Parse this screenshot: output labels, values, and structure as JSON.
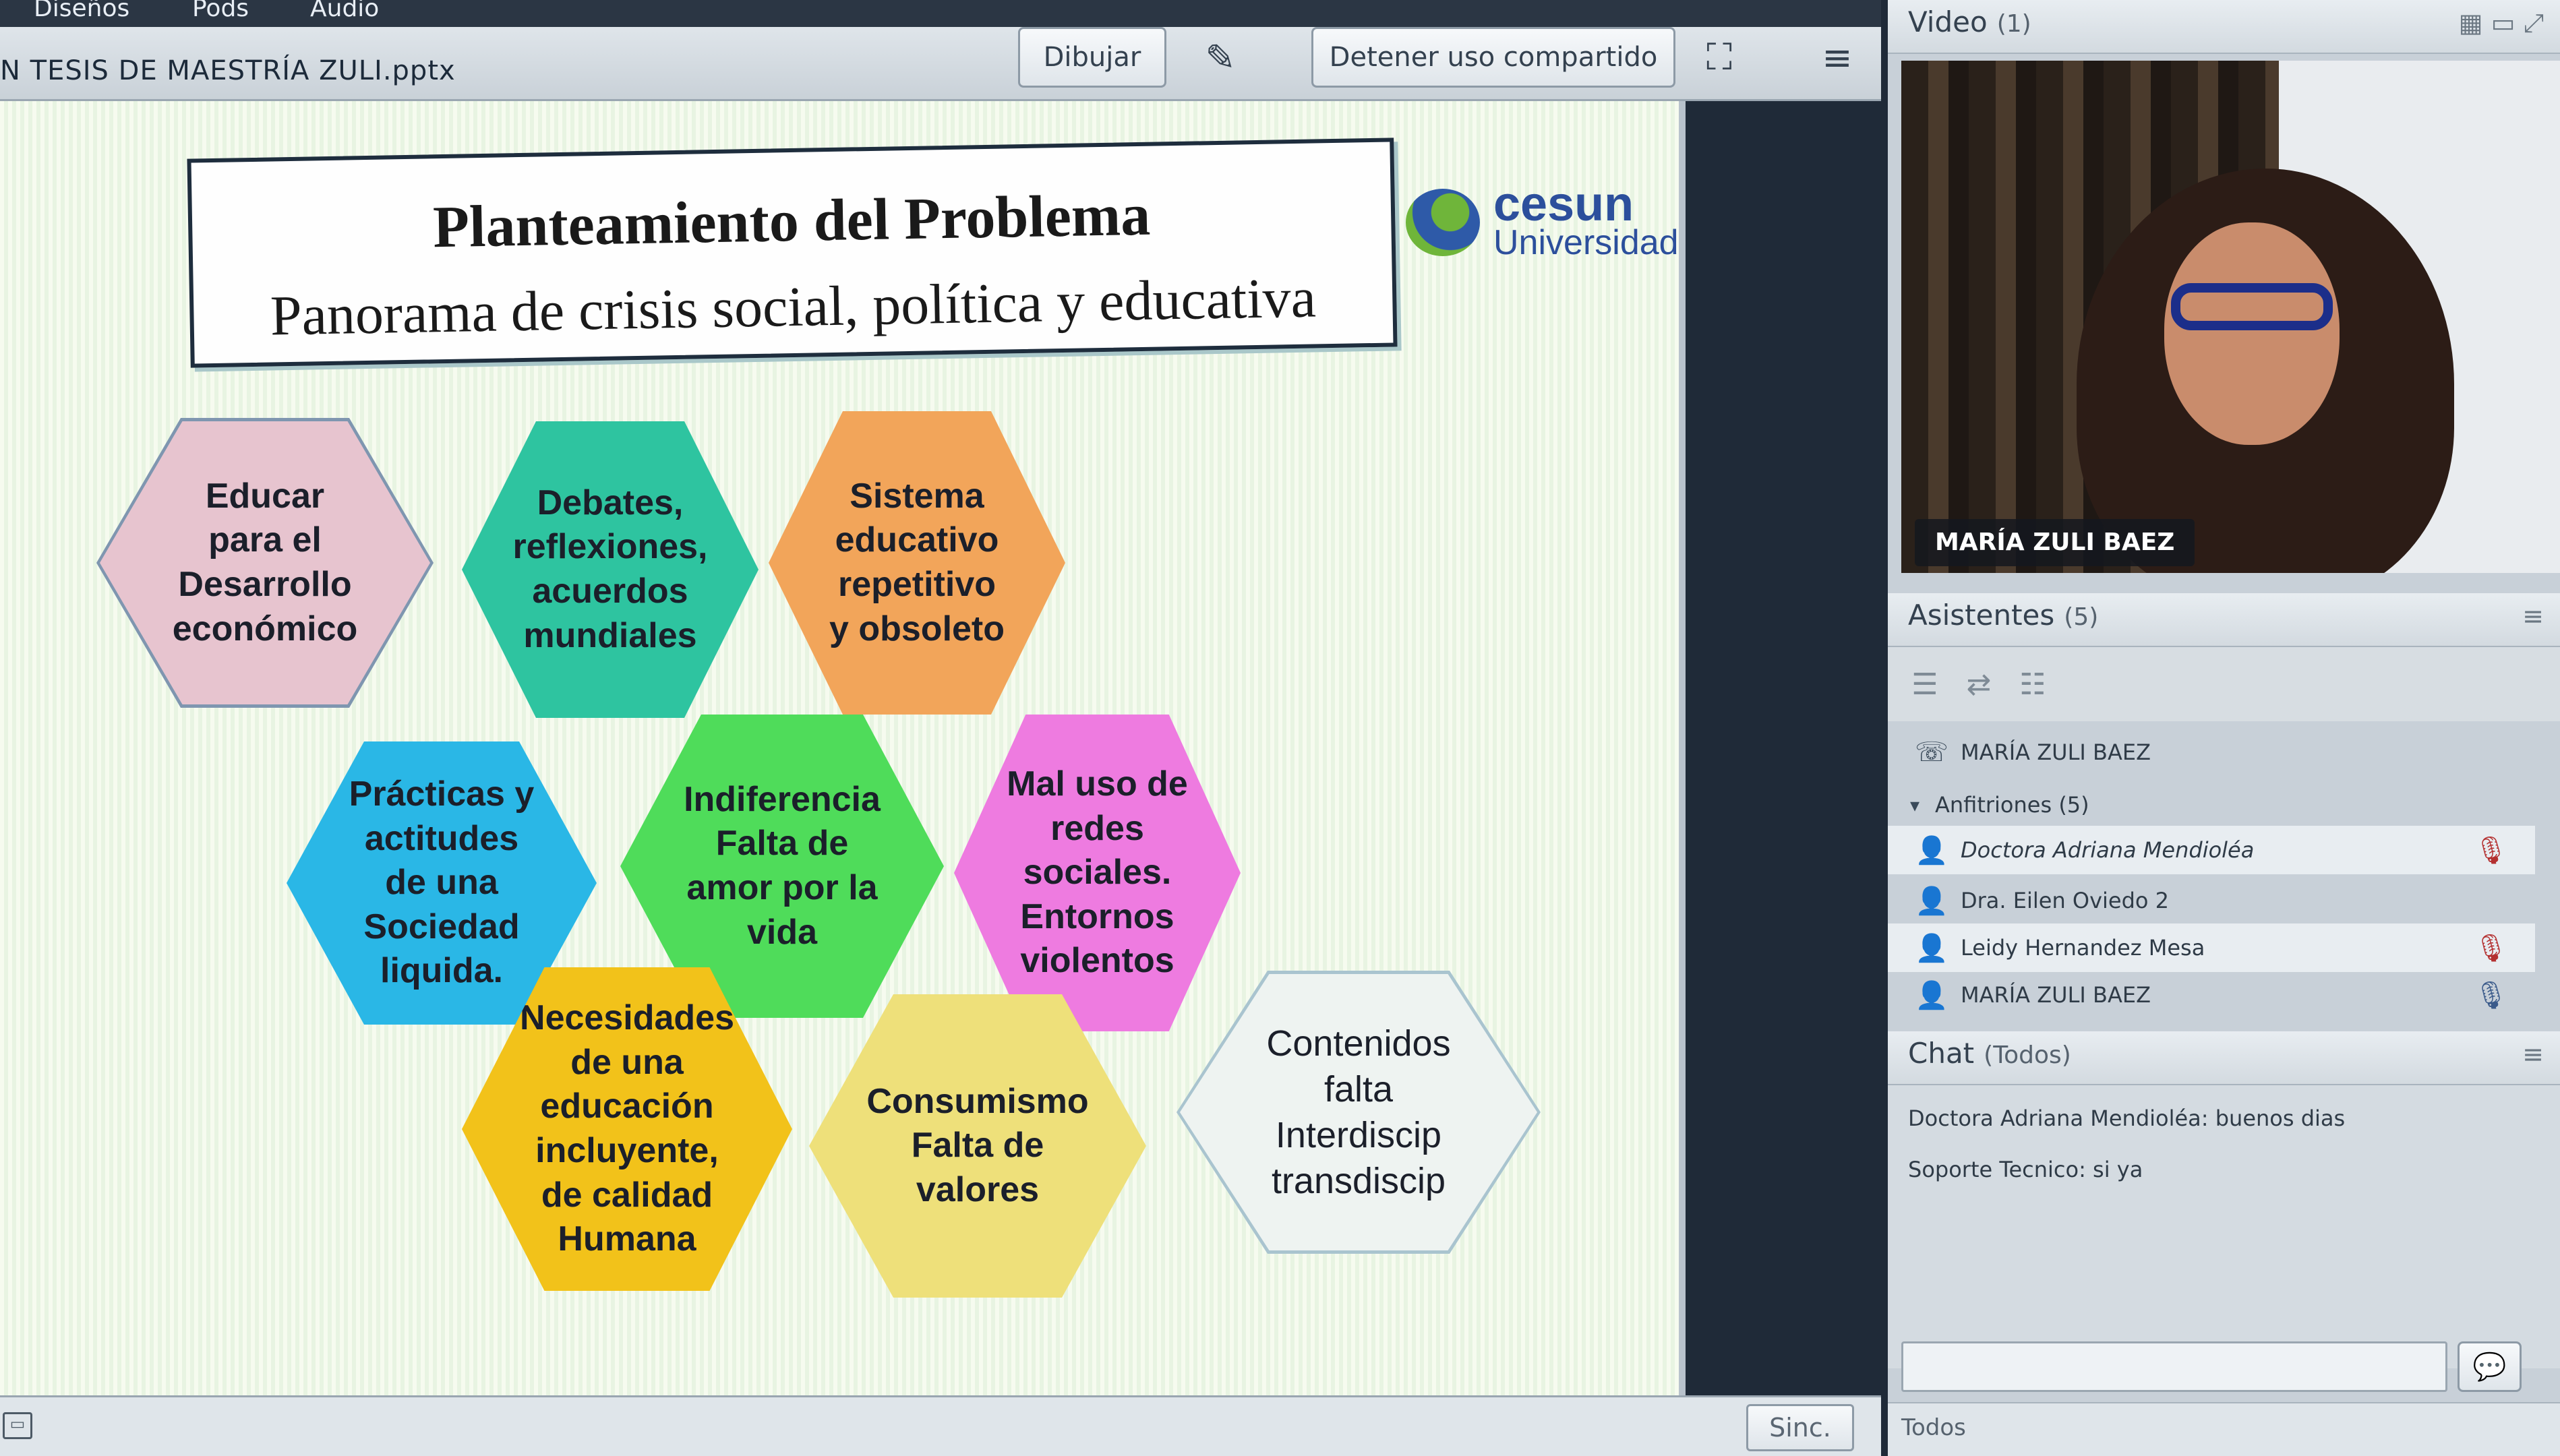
{
  "menubar": {
    "items": [
      "Diseños",
      "Pods",
      "Audio"
    ]
  },
  "toolbar": {
    "file_name": "N TESIS DE MAESTRÍA ZULI.pptx",
    "draw_label": "Dibujar",
    "pointer_icon": "pointer-icon",
    "stop_share_label": "Detener uso compartido",
    "fullscreen_icon": "fullscreen-icon",
    "menu_icon": "menu-icon"
  },
  "slide": {
    "logo": {
      "brand": "cesun",
      "sub": "Universidad"
    },
    "title": "Planteamiento del Problema",
    "subtitle": "Panorama de crisis social, política y educativa",
    "hexagons": [
      {
        "text": "Educar\npara el\nDesarrollo\neconómico",
        "color": "#e7c4cf"
      },
      {
        "text": "Debates,\nreflexiones,\nacuerdos\nmundiales",
        "color": "#2ec4a0"
      },
      {
        "text": "Sistema\neducativo\nrepetitivo\ny obsoleto",
        "color": "#f2a55a"
      },
      {
        "text": "Prácticas  y\nactitudes\nde una\nSociedad\nliquida.",
        "color": "#2ab7e6"
      },
      {
        "text": "Indiferencia\nFalta de\namor por la\nvida",
        "color": "#4fdc5a"
      },
      {
        "text": "Mal uso de\nredes\nsociales.\nEntornos\nviolentos",
        "color": "#ee7be0"
      },
      {
        "text": "Necesidades\nde una\neducación\nincluyente,\nde  calidad\nHumana",
        "color": "#f2c21a"
      },
      {
        "text": "Consumismo\nFalta de\nvalores",
        "color": "#eee07a"
      },
      {
        "text": "Contenidos\nfalta\nInterdiscip\ntransdiscip",
        "color": "#eef3f1"
      }
    ]
  },
  "status": {
    "sync_label": "Sinc."
  },
  "video_pod": {
    "title": "Video",
    "count": "(1)",
    "speaker_name": "MARÍA ZULI  BAEZ"
  },
  "attendees_pod": {
    "title": "Asistentes",
    "count": "(5)",
    "presenter": "MARÍA ZULI  BAEZ",
    "group_label": "Anfitriones (5)",
    "hosts": [
      {
        "name": "Doctora Adriana Mendioléa",
        "mic": true
      },
      {
        "name": "Dra. Eilen Oviedo 2",
        "mic": false
      },
      {
        "name": "Leidy Hernandez Mesa",
        "mic": true
      },
      {
        "name": "MARÍA ZULI  BAEZ",
        "mic": true
      }
    ]
  },
  "chat_pod": {
    "title": "Chat",
    "scope": "(Todos)",
    "messages": [
      "Doctora Adriana Mendioléa: buenos dias",
      "Soporte Tecnico: si ya"
    ],
    "target": "Todos"
  }
}
